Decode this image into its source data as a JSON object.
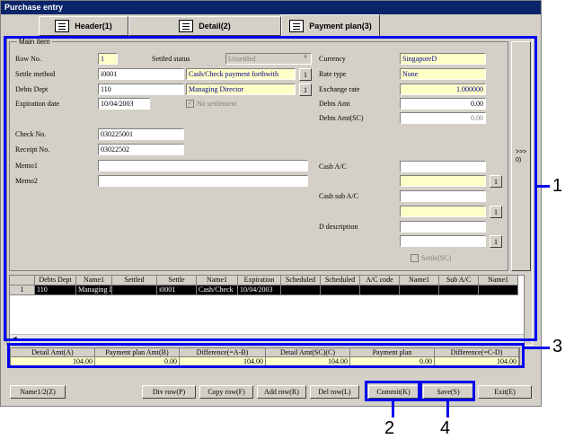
{
  "window": {
    "title": "Purchase entry"
  },
  "tabs": [
    {
      "label": "Header(1)",
      "icon": "book-icon"
    },
    {
      "label": "Detail(2)",
      "icon": "document-icon"
    },
    {
      "label": "Payment plan(3)",
      "icon": "monitor-icon"
    }
  ],
  "main_item": {
    "group_label": "Main item",
    "row_no_label": "Row No.",
    "row_no": "1",
    "settled_status_label": "Settled status",
    "settled_status": "Unsettled",
    "settle_method_label": "Settle method",
    "settle_method_code": "i0001",
    "settle_method_name": "Cash/Check payment forthwith",
    "debts_dept_label": "Debts Dept",
    "debts_dept_code": "110",
    "debts_dept_name": "Managing Director",
    "expiration_label": "Expiration date",
    "expiration_date": "10/04/2003",
    "no_settlement_label": "No settlement",
    "check_no_label": "Check No.",
    "check_no": "030225001",
    "receipt_no_label": "Receipt No.",
    "receipt_no": "03022502",
    "memo1_label": "Memo1",
    "memo1": "",
    "memo2_label": "Memo2",
    "memo2": "",
    "currency_label": "Currency",
    "currency": "SingaporeD",
    "rate_type_label": "Rate type",
    "rate_type": "None",
    "exchange_rate_label": "Exchange rate",
    "exchange_rate": "1.000000",
    "debts_amt_label": "Debts Amt",
    "debts_amt": "0.00",
    "debts_amt_sc_label": "Debts Amt(SC)",
    "debts_amt_sc": "0.00",
    "cash_ac_label": "Cash A/C",
    "cash_sub_ac_label": "Cash sub A/C",
    "d_description_label": "D description",
    "settle_sc_label": "Settle(SC)",
    "lookup_btn": "1",
    "side_button": ">>>\n0)"
  },
  "grid": {
    "headers": [
      "",
      "Debts Dept",
      "Name1",
      "Settled",
      "Settle",
      "Name1",
      "Expiration",
      "Scheduled",
      "Scheduled",
      "A/C code",
      "Name1",
      "Sub A/C",
      "Name1"
    ],
    "rows": [
      [
        "1",
        "110",
        "Managing Di",
        "",
        "i0001",
        "Cash/Check",
        "10/04/2003",
        "",
        "",
        "",
        "",
        "",
        ""
      ]
    ]
  },
  "summary": {
    "headers": [
      "Detail Amt(A)",
      "Payment plan Amt(B)",
      "Difference(=A-B)",
      "Detail Amt(SC)(C)",
      "Payment plan",
      "Difference(=C-D)"
    ],
    "values": [
      "104.00",
      "0.00",
      "104.00",
      "104.00",
      "0.00",
      "104.00"
    ]
  },
  "buttons": {
    "name12": "Name1/2(Z)",
    "div_row": "Div row(P)",
    "copy_row": "Copy row(F)",
    "add_row": "Add row(R)",
    "del_row": "Del row(L)",
    "commit": "Commit(K)",
    "save": "Save(S)",
    "exit": "Exit(E)"
  },
  "callouts": {
    "c1": "1",
    "c2": "2",
    "c3": "3",
    "c4": "4"
  },
  "colors": {
    "callout": "#0000ee",
    "titlebar": "#0a246a",
    "highlight_field": "#ffffc8"
  }
}
